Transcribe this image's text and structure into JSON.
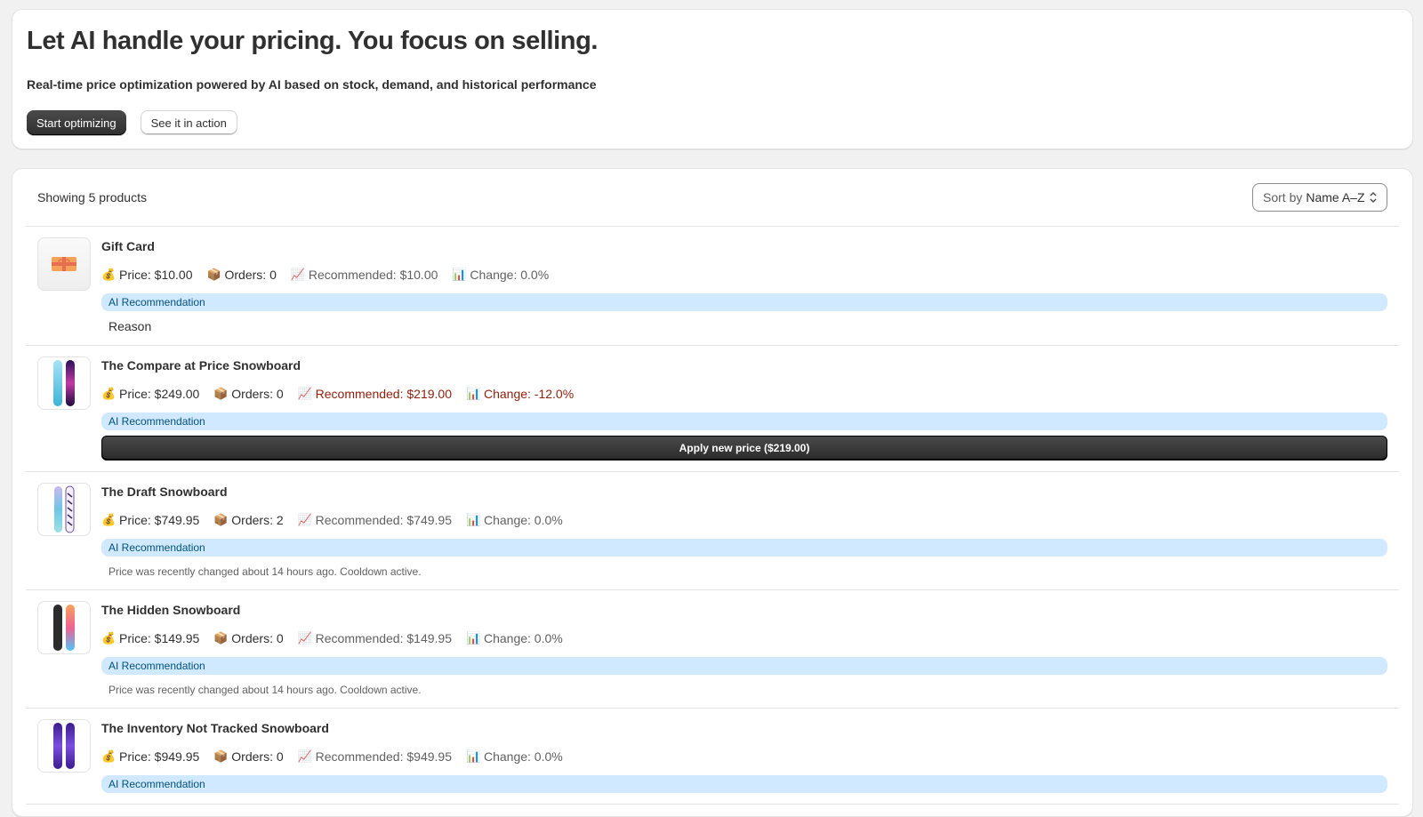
{
  "hero": {
    "title": "Let AI handle your pricing. You focus on selling.",
    "subtitle": "Real-time price optimization powered by AI based on stock, demand, and historical performance",
    "primary_button": "Start optimizing",
    "secondary_button": "See it in action"
  },
  "list": {
    "count_text": "Showing 5 products",
    "sort_label": "Sort by",
    "sort_value": "Name A–Z",
    "ai_label": "AI Recommendation"
  },
  "icons": {
    "price": "💰",
    "orders": "📦",
    "recommended": "📈",
    "change": "📊"
  },
  "colors": {
    "critical": "#8e1f0b",
    "ai_bar_bg": "#d1e9ff",
    "ai_bar_text": "#00527c"
  },
  "products": [
    {
      "name": "Gift Card",
      "price": "Price: $10.00",
      "orders": "Orders: 0",
      "recommended": "Recommended: $10.00",
      "change": "Change: 0.0%",
      "reason": "Reason"
    },
    {
      "name": "The Compare at Price Snowboard",
      "price": "Price: $249.00",
      "orders": "Orders: 0",
      "recommended": "Recommended: $219.00",
      "change": "Change: -12.0%",
      "apply_label": "Apply new price ($219.00)"
    },
    {
      "name": "The Draft Snowboard",
      "price": "Price: $749.95",
      "orders": "Orders: 2",
      "recommended": "Recommended: $749.95",
      "change": "Change: 0.0%",
      "note": "Price was recently changed about 14 hours ago. Cooldown active."
    },
    {
      "name": "The Hidden Snowboard",
      "price": "Price: $149.95",
      "orders": "Orders: 0",
      "recommended": "Recommended: $149.95",
      "change": "Change: 0.0%",
      "note": "Price was recently changed about 14 hours ago. Cooldown active."
    },
    {
      "name": "The Inventory Not Tracked Snowboard",
      "price": "Price: $949.95",
      "orders": "Orders: 0",
      "recommended": "Recommended: $949.95",
      "change": "Change: 0.0%"
    }
  ]
}
